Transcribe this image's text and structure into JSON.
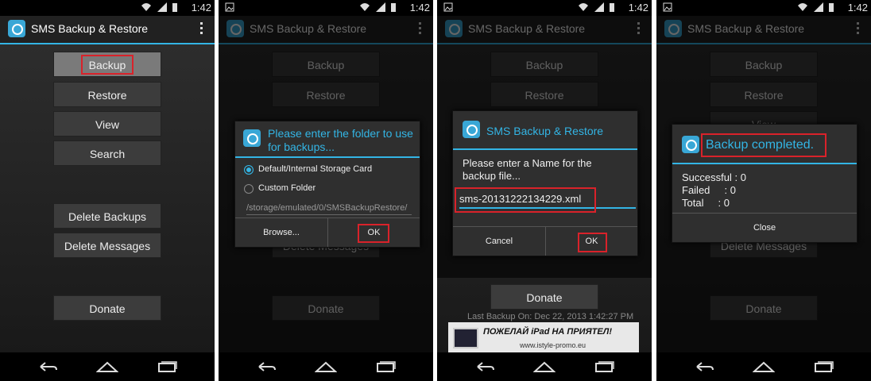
{
  "status": {
    "time": "1:42"
  },
  "app": {
    "title": "SMS Backup & Restore"
  },
  "buttons": {
    "backup": "Backup",
    "restore": "Restore",
    "view": "View",
    "search": "Search",
    "delete_backups": "Delete Backups",
    "delete_messages": "Delete Messages",
    "donate": "Donate"
  },
  "screen2": {
    "dialog_title": "Please enter the folder to use for backups...",
    "option_default": "Default/Internal Storage Card",
    "option_custom": "Custom Folder",
    "path": "/storage/emulated/0/SMSBackupRestore/",
    "browse": "Browse...",
    "ok": "OK"
  },
  "screen3": {
    "dialog_title": "SMS Backup & Restore",
    "prompt": "Please enter a Name for the backup file...",
    "filename": "sms-20131222134229.xml",
    "cancel": "Cancel",
    "ok": "OK",
    "last_backup": "Last Backup On: Dec 22, 2013 1:42:27 PM",
    "banner_text": "ПОЖЕЛАЙ iPad НА ПРИЯТЕЛ!",
    "banner_url": "www.istyle-promo.eu"
  },
  "screen4": {
    "dialog_title": "Backup completed.",
    "successful": "Successful : 0",
    "failed": "Failed     : 0",
    "total": "Total     : 0",
    "close": "Close"
  },
  "colors": {
    "accent": "#33b5e5",
    "highlight": "#d9222a"
  }
}
